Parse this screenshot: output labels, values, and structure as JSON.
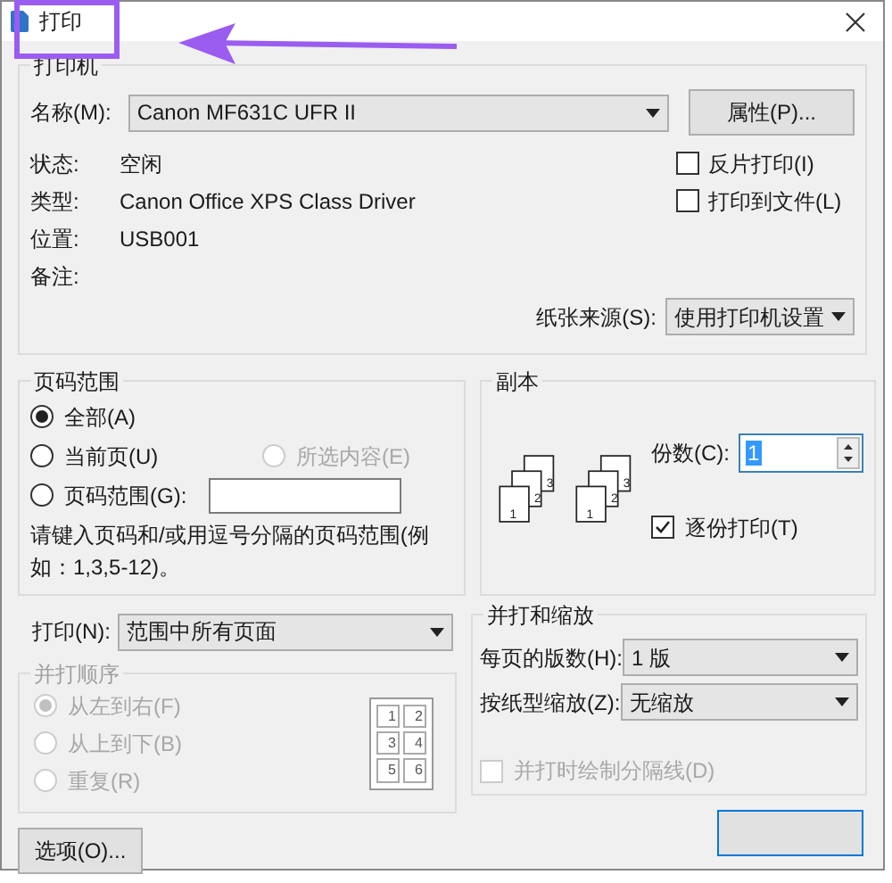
{
  "window": {
    "title": "打印"
  },
  "printer": {
    "legend": "打印机",
    "name_label": "名称(M):",
    "name_value": "Canon MF631C UFR II",
    "properties_button": "属性(P)...",
    "info": [
      {
        "label": "状态:",
        "value": "空闲"
      },
      {
        "label": "类型:",
        "value": "Canon Office XPS Class Driver"
      },
      {
        "label": "位置:",
        "value": "USB001"
      },
      {
        "label": "备注:"
      }
    ],
    "options": [
      {
        "label": "反片打印(I)",
        "checked": false
      },
      {
        "label": "打印到文件(L)",
        "checked": false
      }
    ],
    "paper_source": {
      "label": "纸张来源(S):",
      "value": "使用打印机设置"
    }
  },
  "page_range": {
    "legend": "页码范围",
    "radios": [
      {
        "label": "全部(A)",
        "selected": true,
        "disabled": false
      },
      {
        "label": "当前页(U)",
        "selected": false,
        "disabled": false
      },
      {
        "label": "所选内容(E)",
        "selected": false,
        "disabled": true
      },
      {
        "label": "页码范围(G):",
        "selected": false,
        "disabled": false
      }
    ],
    "hint": "请键入页码和/或用逗号分隔的页码范围(例如：1,3,5-12)。"
  },
  "copies": {
    "legend": "副本",
    "stacks": [
      [
        "1",
        "2",
        "3"
      ],
      [
        "1",
        "2",
        "3"
      ]
    ],
    "count_label": "份数(C):",
    "count_value": "1",
    "collate": {
      "label": "逐份打印(T)",
      "checked": true
    }
  },
  "print_what": {
    "label": "打印(N):",
    "value": "范围中所有页面"
  },
  "collate_order": {
    "legend": "并打顺序",
    "disabled": true,
    "radios": [
      {
        "label": "从左到右(F)",
        "selected": true
      },
      {
        "label": "从上到下(B)",
        "selected": false
      },
      {
        "label": "重复(R)",
        "selected": false
      }
    ],
    "preview_numbers": [
      "1",
      "2",
      "3",
      "4",
      "5",
      "6"
    ]
  },
  "zoom": {
    "legend": "并打和缩放",
    "rows": [
      {
        "label": "每页的版数(H):",
        "value": "1 版"
      },
      {
        "label": "按纸型缩放(Z):",
        "value": "无缩放"
      }
    ],
    "draw_borders": {
      "label": "并打时绘制分隔线(D)",
      "checked": false,
      "disabled": true
    }
  },
  "buttons": {
    "options": "选项(O)..."
  }
}
